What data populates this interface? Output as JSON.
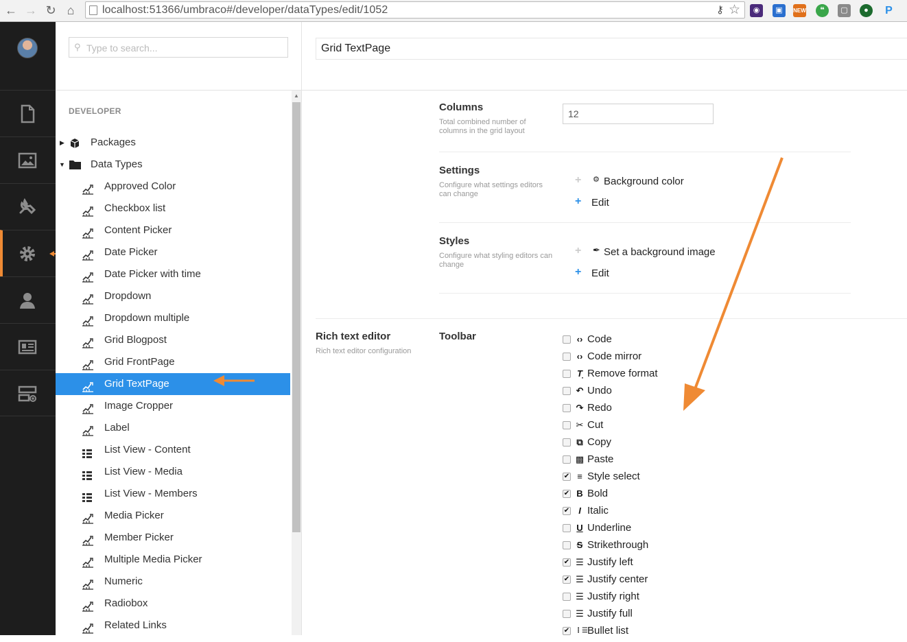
{
  "browser": {
    "url": "localhost:51366/umbraco#/developer/dataTypes/edit/1052"
  },
  "search": {
    "placeholder": "Type to search..."
  },
  "tree": {
    "section_label": "DEVELOPER",
    "top_nodes": [
      {
        "label": "Packages",
        "icon": "package-icon"
      },
      {
        "label": "Data Types",
        "icon": "folder-icon"
      }
    ],
    "items": [
      {
        "label": "Approved Color",
        "icon": "datatype-icon"
      },
      {
        "label": "Checkbox list",
        "icon": "datatype-icon"
      },
      {
        "label": "Content Picker",
        "icon": "datatype-icon"
      },
      {
        "label": "Date Picker",
        "icon": "datatype-icon"
      },
      {
        "label": "Date Picker with time",
        "icon": "datatype-icon"
      },
      {
        "label": "Dropdown",
        "icon": "datatype-icon"
      },
      {
        "label": "Dropdown multiple",
        "icon": "datatype-icon"
      },
      {
        "label": "Grid Blogpost",
        "icon": "datatype-icon"
      },
      {
        "label": "Grid FrontPage",
        "icon": "datatype-icon"
      },
      {
        "label": "Grid TextPage",
        "icon": "datatype-icon",
        "selected": true
      },
      {
        "label": "Image Cropper",
        "icon": "datatype-icon"
      },
      {
        "label": "Label",
        "icon": "datatype-icon"
      },
      {
        "label": "List View - Content",
        "icon": "list-view-icon"
      },
      {
        "label": "List View - Media",
        "icon": "list-view-icon"
      },
      {
        "label": "List View - Members",
        "icon": "list-view-icon"
      },
      {
        "label": "Media Picker",
        "icon": "datatype-icon"
      },
      {
        "label": "Member Picker",
        "icon": "datatype-icon"
      },
      {
        "label": "Multiple Media Picker",
        "icon": "datatype-icon"
      },
      {
        "label": "Numeric",
        "icon": "datatype-icon"
      },
      {
        "label": "Radiobox",
        "icon": "datatype-icon"
      },
      {
        "label": "Related Links",
        "icon": "datatype-icon"
      }
    ]
  },
  "editor": {
    "title": "Grid TextPage",
    "columns": {
      "label": "Columns",
      "desc": "Total combined number of columns in the grid layout",
      "value": "12"
    },
    "settings": {
      "label": "Settings",
      "desc": "Configure what settings editors can change",
      "item": "Background color",
      "edit": "Edit"
    },
    "styles": {
      "label": "Styles",
      "desc": "Configure what styling editors can change",
      "item": "Set a background image",
      "edit": "Edit"
    },
    "rte": {
      "label": "Rich text editor",
      "desc": "Rich text editor configuration"
    },
    "toolbar": {
      "label": "Toolbar",
      "items": [
        {
          "label": "Code",
          "checked": false,
          "icon": "code-icon"
        },
        {
          "label": "Code mirror",
          "checked": false,
          "icon": "code-icon"
        },
        {
          "label": "Remove format",
          "checked": false,
          "icon": "remove-format-icon"
        },
        {
          "label": "Undo",
          "checked": false,
          "icon": "undo-icon"
        },
        {
          "label": "Redo",
          "checked": false,
          "icon": "redo-icon"
        },
        {
          "label": "Cut",
          "checked": false,
          "icon": "cut-icon"
        },
        {
          "label": "Copy",
          "checked": false,
          "icon": "copy-icon"
        },
        {
          "label": "Paste",
          "checked": false,
          "icon": "paste-icon"
        },
        {
          "label": "Style select",
          "checked": true,
          "icon": "style-select-icon"
        },
        {
          "label": "Bold",
          "checked": true,
          "icon": "bold-icon"
        },
        {
          "label": "Italic",
          "checked": true,
          "icon": "italic-icon"
        },
        {
          "label": "Underline",
          "checked": false,
          "icon": "underline-icon"
        },
        {
          "label": "Strikethrough",
          "checked": false,
          "icon": "strikethrough-icon"
        },
        {
          "label": "Justify left",
          "checked": true,
          "icon": "justify-left-icon"
        },
        {
          "label": "Justify center",
          "checked": true,
          "icon": "justify-center-icon"
        },
        {
          "label": "Justify right",
          "checked": false,
          "icon": "justify-right-icon"
        },
        {
          "label": "Justify full",
          "checked": false,
          "icon": "justify-full-icon"
        },
        {
          "label": "Bullet list",
          "checked": true,
          "icon": "bullet-list-icon"
        }
      ]
    }
  },
  "colors": {
    "accent": "#2c90e8",
    "annotation": "#ef8a34",
    "sidebar": "#1d1d1d"
  }
}
